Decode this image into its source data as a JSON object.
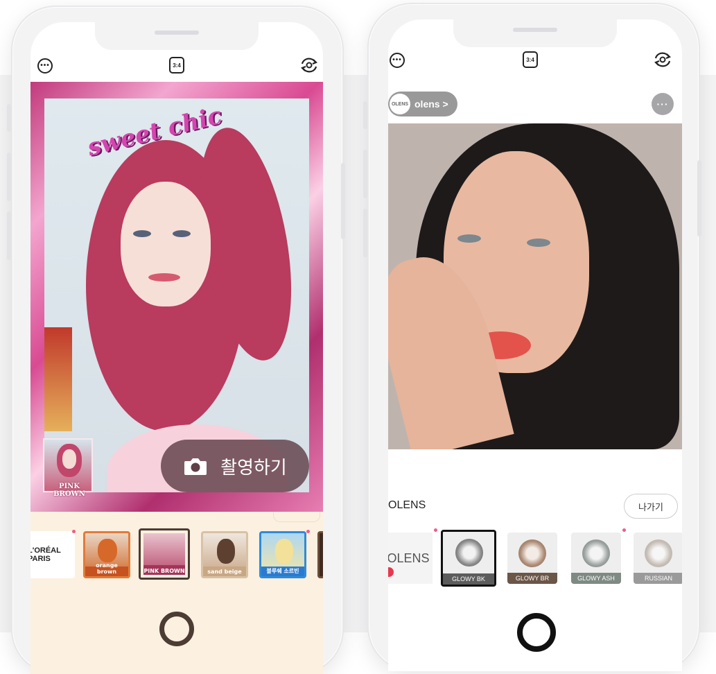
{
  "left_app": {
    "top_bar": {
      "more_icon": "ellipsis-circle-icon",
      "aspect_ratio": "3:4",
      "flip_icon": "camera-flip-icon"
    },
    "sticker_text": "sweet chic",
    "preview_thumb_label": "PINK BROWN",
    "shoot_button": {
      "icon": "camera-icon",
      "label": "촬영하기"
    },
    "filters": [
      {
        "label": "L'ORÉAL PARIS",
        "type": "brand"
      },
      {
        "label": "orange brown"
      },
      {
        "label": "PINK BROWN",
        "selected": true
      },
      {
        "label": "sand beige"
      },
      {
        "label": "블루쉐 소르빈"
      },
      {
        "label": ""
      }
    ]
  },
  "right_app": {
    "top_bar": {
      "more_icon": "ellipsis-circle-icon",
      "aspect_ratio": "3:4",
      "flip_icon": "camera-flip-icon"
    },
    "brand_pill": {
      "logo_text": "OLENS",
      "name": "olens >"
    },
    "more_button": "···",
    "section_label": "OLENS",
    "exit_button": "나가기",
    "brand_tile": "OLENS",
    "lenses": [
      {
        "label": "GLOWY BK",
        "selected": true,
        "color": "#5c5c5c"
      },
      {
        "label": "GLOWY BR",
        "color": "#6b5648"
      },
      {
        "label": "GLOWY ASH",
        "color": "#7e8a84"
      },
      {
        "label": "RUSSIAN",
        "color": "#9a9a9a"
      }
    ]
  }
}
